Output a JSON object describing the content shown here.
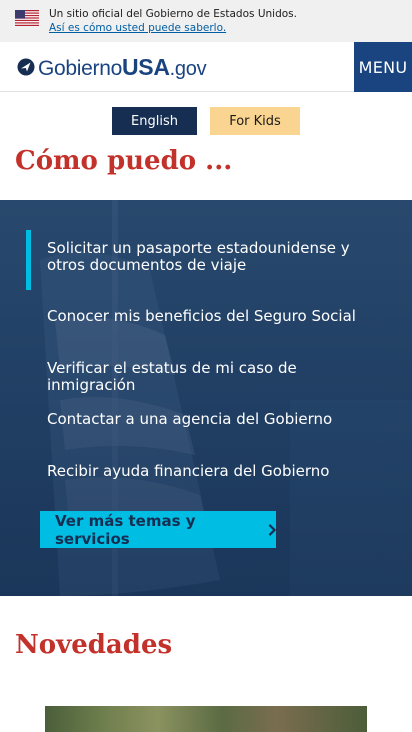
{
  "banner": {
    "official_text": "Un sitio oficial del Gobierno de Estados Unidos.",
    "how_you_know": "Así es cómo usted puede saberlo."
  },
  "header": {
    "logo_prefix": "Gobierno",
    "logo_usa": "USA",
    "logo_gov": ".gov",
    "menu_label": "MENU"
  },
  "language": {
    "english": "English",
    "kids": "For Kids"
  },
  "how_section": {
    "title": "Cómo puedo ...",
    "items": [
      "Solicitar un pasaporte estadounidense y otros documentos de viaje",
      "Conocer mis beneficios del Seguro Social",
      "Verificar el estatus de mi caso de inmigración",
      "Contactar a una agencia del Gobierno",
      "Recibir ayuda financiera del Gobierno"
    ],
    "cta_label": "Ver más temas y servicios"
  },
  "news_section": {
    "title": "Novedades"
  },
  "colors": {
    "brand_blue": "#1a4480",
    "title_red": "#c3312b",
    "accent_cyan": "#00bde3",
    "kids_yellow": "#f9d591"
  },
  "icons": [
    "us-flag-icon",
    "usa-gov-logo-icon",
    "chevron-right-icon"
  ]
}
